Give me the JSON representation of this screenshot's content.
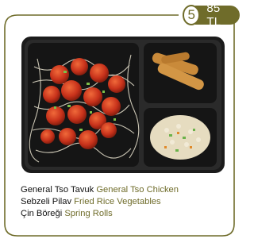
{
  "badge": {
    "number": "5",
    "price": "85 TL"
  },
  "menu_items": [
    {
      "tr": "General Tso Tavuk",
      "en": "General Tso Chicken"
    },
    {
      "tr": "Sebzeli Pilav",
      "en": "Fried Rice Vegetables"
    },
    {
      "tr": "Çin Böreği",
      "en": "Spring Rolls"
    }
  ],
  "colors": {
    "accent": "#6f6c2a",
    "tray": "#1e1e1e"
  }
}
